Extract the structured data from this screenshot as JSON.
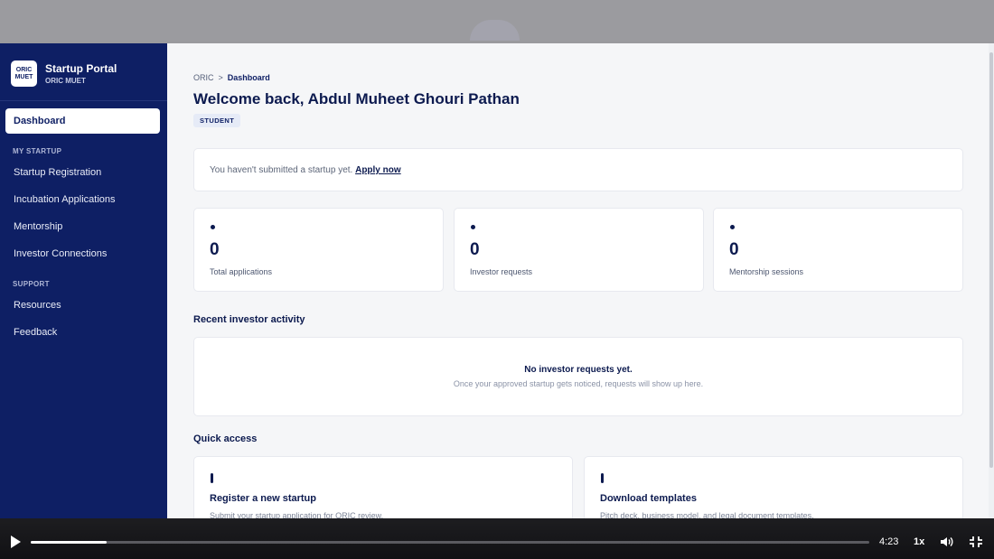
{
  "sidebar": {
    "logo_line1": "ORIC",
    "logo_line2": "MUET",
    "title": "Startup Portal",
    "subtitle": "ORIC MUET",
    "active_item": "Dashboard",
    "sections": [
      {
        "label": "MY STARTUP",
        "items": [
          "Startup Registration",
          "Incubation Applications",
          "Mentorship",
          "Investor Connections"
        ]
      },
      {
        "label": "SUPPORT",
        "items": [
          "Resources",
          "Feedback"
        ]
      }
    ]
  },
  "breadcrumb": {
    "root": "ORIC",
    "separator": ">",
    "current": "Dashboard"
  },
  "welcome": "Welcome back, Abdul Muheet Ghouri Pathan",
  "role_badge": "STUDENT",
  "notice": {
    "text": "You haven't submitted a startup yet.",
    "link": "Apply now"
  },
  "stats": [
    {
      "value": "0",
      "label": "Total applications"
    },
    {
      "value": "0",
      "label": "Investor requests"
    },
    {
      "value": "0",
      "label": "Mentorship sessions"
    }
  ],
  "recent_activity": {
    "title": "Recent investor activity",
    "empty_title": "No investor requests yet.",
    "empty_desc": "Once your approved startup gets noticed, requests will show up here."
  },
  "quick_access": {
    "title": "Quick access",
    "cards": [
      {
        "title": "Register a new startup",
        "desc": "Submit your startup application for ORIC review."
      },
      {
        "title": "Download templates",
        "desc": "Pitch deck, business model, and legal document templates."
      }
    ]
  },
  "player": {
    "time": "4:23",
    "speed": "1x",
    "progress_fraction": 0.09,
    "icons": [
      "play-icon",
      "volume-icon",
      "exit-fullscreen-icon"
    ]
  }
}
